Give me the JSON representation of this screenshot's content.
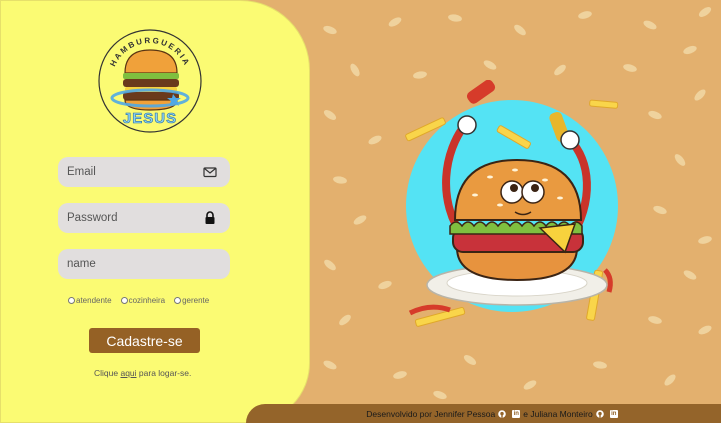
{
  "brand": {
    "arc_text": "HAMBURGUERIA",
    "name": "JESUS"
  },
  "form": {
    "email_placeholder": "Email",
    "email_icon": "envelope-icon",
    "password_placeholder": "Password",
    "password_icon": "lock-icon",
    "name_placeholder": "name",
    "roles": [
      "atendente",
      "cozinheira",
      "gerente"
    ],
    "submit_label": "Cadastre-se"
  },
  "login_hint": {
    "prefix": "Clique ",
    "link": "aqui",
    "suffix": " para logar-se."
  },
  "footer": {
    "text_1": "Desenvolvido por Jennifer Pessoa",
    "icon_1": "github-icon",
    "icon_2": "linkedin-icon",
    "text_2": "e Juliana Monteiro",
    "icon_3": "github-icon",
    "icon_4": "linkedin-icon"
  },
  "colors": {
    "panel": "#fbfb73",
    "background": "#e3b06e",
    "button": "#956125",
    "footer": "#94642a",
    "hero_circle": "#54e3f4"
  }
}
